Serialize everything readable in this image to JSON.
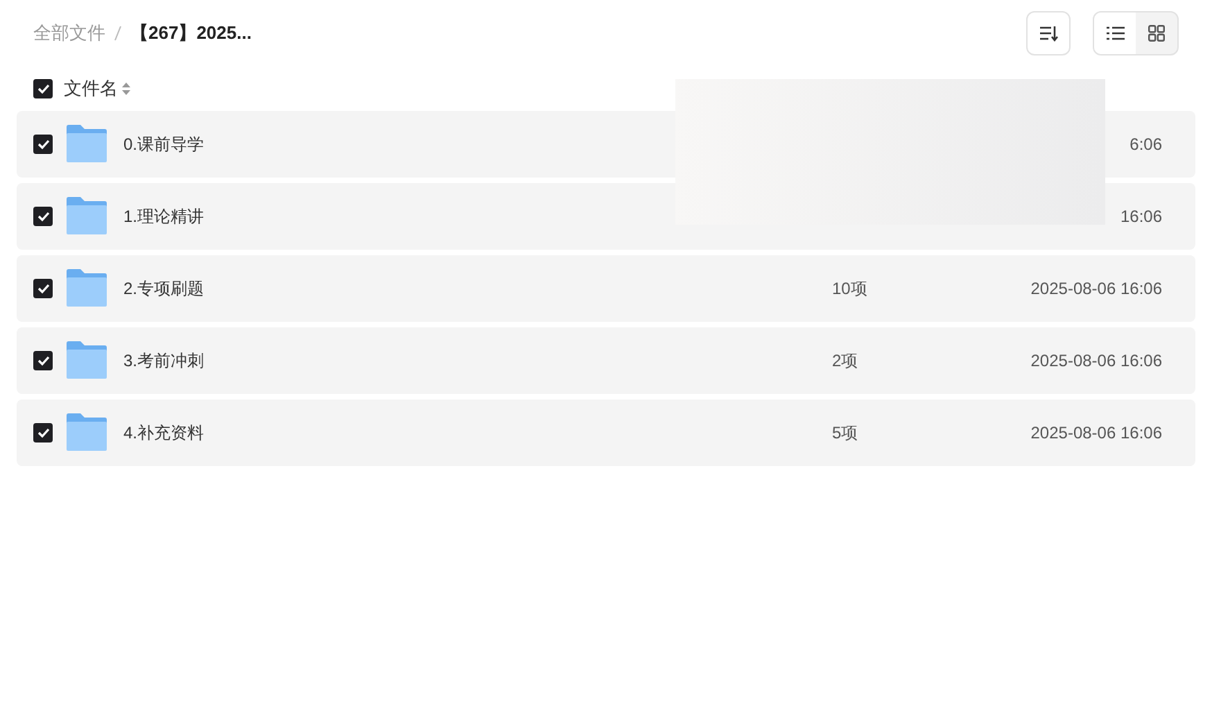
{
  "breadcrumb": [
    {
      "label": "全部文件",
      "current": false
    },
    {
      "label": "【267】2025...",
      "current": true
    }
  ],
  "toolbar": {
    "view_modes": [
      {
        "kind": "list",
        "selected": true
      },
      {
        "kind": "grid",
        "selected": false
      }
    ]
  },
  "header": {
    "checked": true,
    "label": "文件名"
  },
  "rows": [
    {
      "checked": true,
      "name": "0.课前导学",
      "date": "6:06"
    },
    {
      "checked": true,
      "name": "1.理论精讲",
      "date": "16:06"
    },
    {
      "checked": true,
      "name": "2.专项刷题",
      "count": "10项",
      "date": "2025-08-06 16:06"
    },
    {
      "checked": true,
      "name": "3.考前冲刺",
      "count": "2项",
      "date": "2025-08-06 16:06"
    },
    {
      "checked": true,
      "name": "4.补充资料",
      "count": "5项",
      "date": "2025-08-06 16:06"
    }
  ]
}
